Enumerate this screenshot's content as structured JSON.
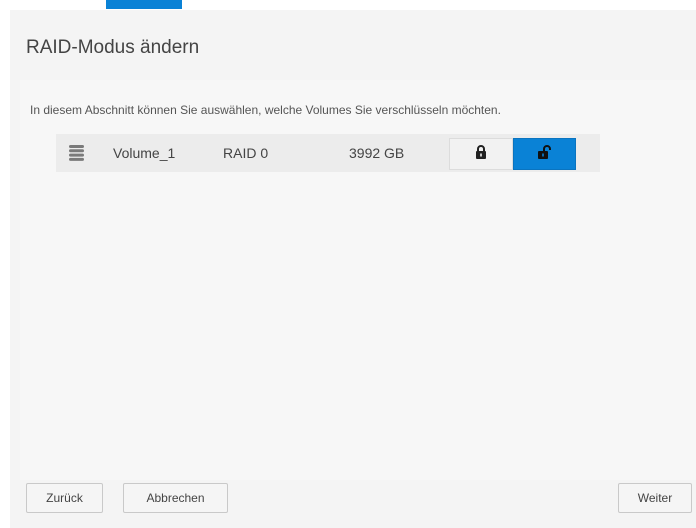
{
  "dialog": {
    "title": "RAID-Modus ändern",
    "description": "In diesem Abschnitt können Sie auswählen, welche Volumes Sie verschlüsseln möchten."
  },
  "volume": {
    "icon": "database-icon",
    "name": "Volume_1",
    "raid": "RAID 0",
    "size": "3992 GB",
    "lock_icon": "lock-icon",
    "unlock_icon": "unlock-icon",
    "selected": "unlocked"
  },
  "footer": {
    "back_label": "Zurück",
    "cancel_label": "Abbrechen",
    "next_label": "Weiter"
  },
  "colors": {
    "accent": "#0a82d6",
    "panel": "#f4f4f4",
    "row": "#ececec"
  }
}
